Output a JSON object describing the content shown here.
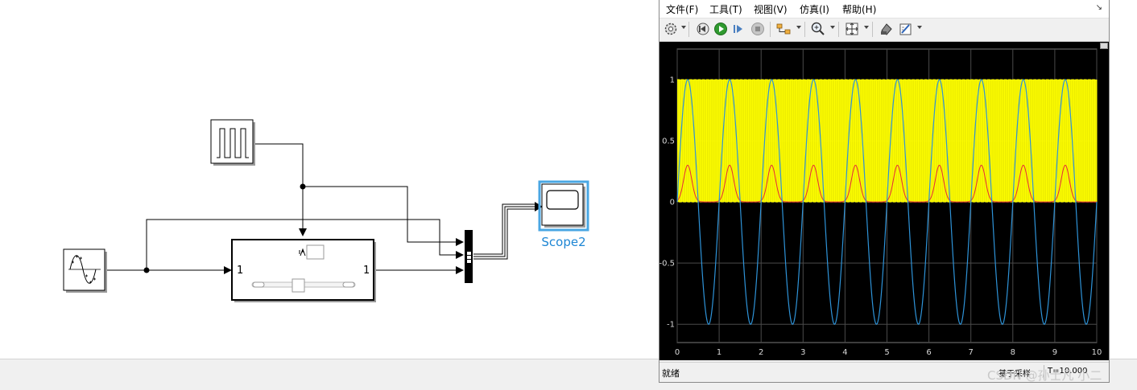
{
  "model": {
    "scope_label": "Scope2",
    "subsystem_input_port": "1",
    "subsystem_output_port": "1"
  },
  "scope_window": {
    "menu": [
      {
        "label": "文件(F)"
      },
      {
        "label": "工具(T)"
      },
      {
        "label": "视图(V)"
      },
      {
        "label": "仿真(I)"
      },
      {
        "label": "帮助(H)"
      }
    ],
    "toolbar_icons": [
      "settings-gear-icon",
      "step-back-icon",
      "run-icon",
      "step-forward-icon",
      "stop-icon",
      "signal-selector-icon",
      "zoom-in-icon",
      "autoscale-icon",
      "print-icon",
      "style-icon"
    ],
    "status": {
      "ready_text": "就绪",
      "mode_text": "基于采样",
      "time_text": "T=10.000"
    }
  },
  "colors": {
    "signal_sine": "#2e93d8",
    "signal_gaussian": "#e8283a",
    "signal_square": "#ffff00",
    "plot_background": "#000000",
    "grid": "#4a4a4a",
    "scope_highlight": "#4aa7e3"
  },
  "chart_data": {
    "type": "line",
    "xlim": [
      0,
      10
    ],
    "ylim": [
      -1.15,
      1.25
    ],
    "xticks": [
      0,
      1,
      2,
      3,
      4,
      5,
      6,
      7,
      8,
      9,
      10
    ],
    "yticks": [
      -1,
      -0.5,
      0,
      0.5,
      1
    ],
    "xtick_labels": [
      "0",
      "1",
      "2",
      "3",
      "4",
      "5",
      "6",
      "7",
      "8",
      "9",
      "10"
    ],
    "ytick_labels": [
      "-1",
      "-0.5",
      "0",
      "0.5",
      "1"
    ],
    "grid": true,
    "series": [
      {
        "kind": "sine",
        "amplitude": 1,
        "period": 1,
        "phase_at_zero": 0,
        "color": "#2e93d8"
      },
      {
        "kind": "square",
        "low": 0,
        "high": 1,
        "period": 0.1,
        "duty": 0.5,
        "color": "#ffff00"
      },
      {
        "kind": "gaussian-pulse",
        "peak": 0.3,
        "period": 1,
        "peaks_at": [
          0.25,
          1.25,
          2.25,
          3.25,
          4.25,
          5.25,
          6.25,
          7.25,
          8.25,
          9.25
        ],
        "half_width": 0.25,
        "color": "#e8283a"
      }
    ]
  },
  "watermark": "CSDN @孙士凡 小二"
}
